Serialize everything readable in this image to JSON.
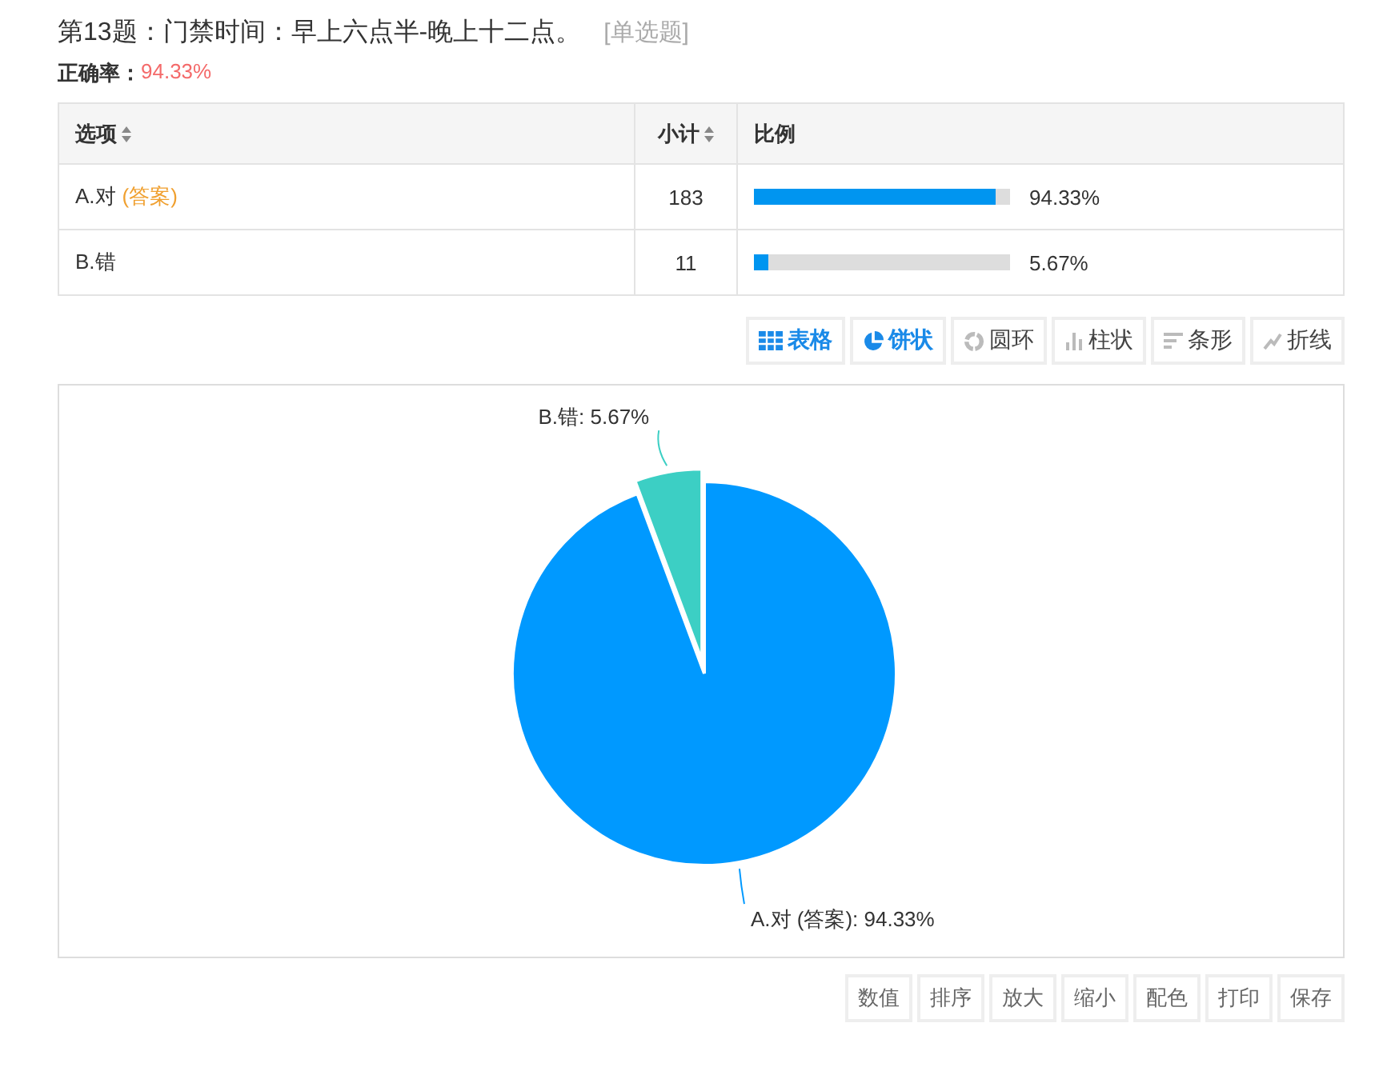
{
  "question": {
    "title": "第13题：门禁时间：早上六点半-晚上十二点。",
    "type": "[单选题]"
  },
  "accuracy": {
    "label": "正确率：",
    "value": "94.33%"
  },
  "table": {
    "columns": [
      "选项",
      "小计",
      "比例"
    ],
    "rows": [
      {
        "option": "A.对",
        "answer_tag": "(答案)",
        "count": "183",
        "level": 0.9433,
        "percent": "94.33%"
      },
      {
        "option": "B.错",
        "count": "11",
        "level": 0.0567,
        "percent": "5.67%"
      }
    ]
  },
  "view_buttons": [
    {
      "kind": "table",
      "label": "表格",
      "selected": true
    },
    {
      "kind": "pie",
      "label": "饼状",
      "selected": true
    },
    {
      "kind": "donut",
      "label": "圆环",
      "selected": false
    },
    {
      "kind": "column",
      "label": "柱状",
      "selected": false
    },
    {
      "kind": "bar",
      "label": "条形",
      "selected": false
    },
    {
      "kind": "line",
      "label": "折线",
      "selected": false
    }
  ],
  "chart": {
    "chart_data": {
      "type": "pie",
      "values": [
        94.33,
        5.67
      ],
      "colors": [
        "#0099ff",
        "#3ccfc4"
      ],
      "data_labels": true,
      "value_labels": [
        "A.对 (答案): 94.33%",
        "B.错: 5.67%"
      ]
    }
  },
  "tool_buttons": [
    "数值",
    "排序",
    "放大",
    "缩小",
    "配色",
    "打印",
    "保存"
  ]
}
